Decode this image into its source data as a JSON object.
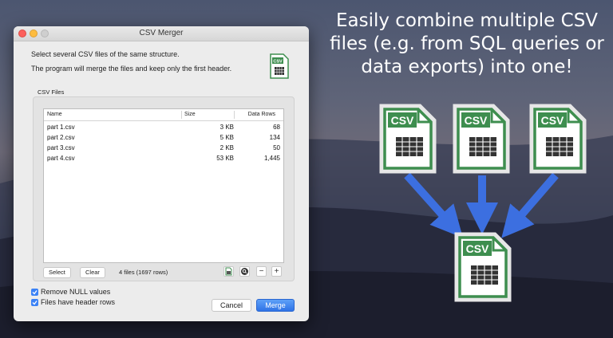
{
  "headline": "Easily combine multiple CSV files (e.g. from SQL queries or data exports) into one!",
  "window": {
    "title": "CSV Merger",
    "description_line1": "Select several CSV files of the same structure.",
    "description_line2": "The program will merge the files and keep only the first header.",
    "group_label": "CSV Files",
    "columns": {
      "name": "Name",
      "size": "Size",
      "rows": "Data Rows"
    },
    "files": [
      {
        "name": "part 1.csv",
        "size": "3 KB",
        "rows": "68"
      },
      {
        "name": "part 2.csv",
        "size": "5 KB",
        "rows": "134"
      },
      {
        "name": "part 3.csv",
        "size": "2 KB",
        "rows": "50"
      },
      {
        "name": "part 4.csv",
        "size": "53 KB",
        "rows": "1,445"
      }
    ],
    "select_label": "Select",
    "clear_label": "Clear",
    "status": "4 files (1697 rows)",
    "remove_null_label": "Remove NULL values",
    "header_rows_label": "Files have header rows",
    "cancel_label": "Cancel",
    "merge_label": "Merge",
    "minus_glyph": "−",
    "plus_glyph": "+"
  },
  "diagram": {
    "file_label": "CSV",
    "colors": {
      "file_green": "#3e8e4f",
      "arrow_blue": "#3c6fe0"
    }
  }
}
